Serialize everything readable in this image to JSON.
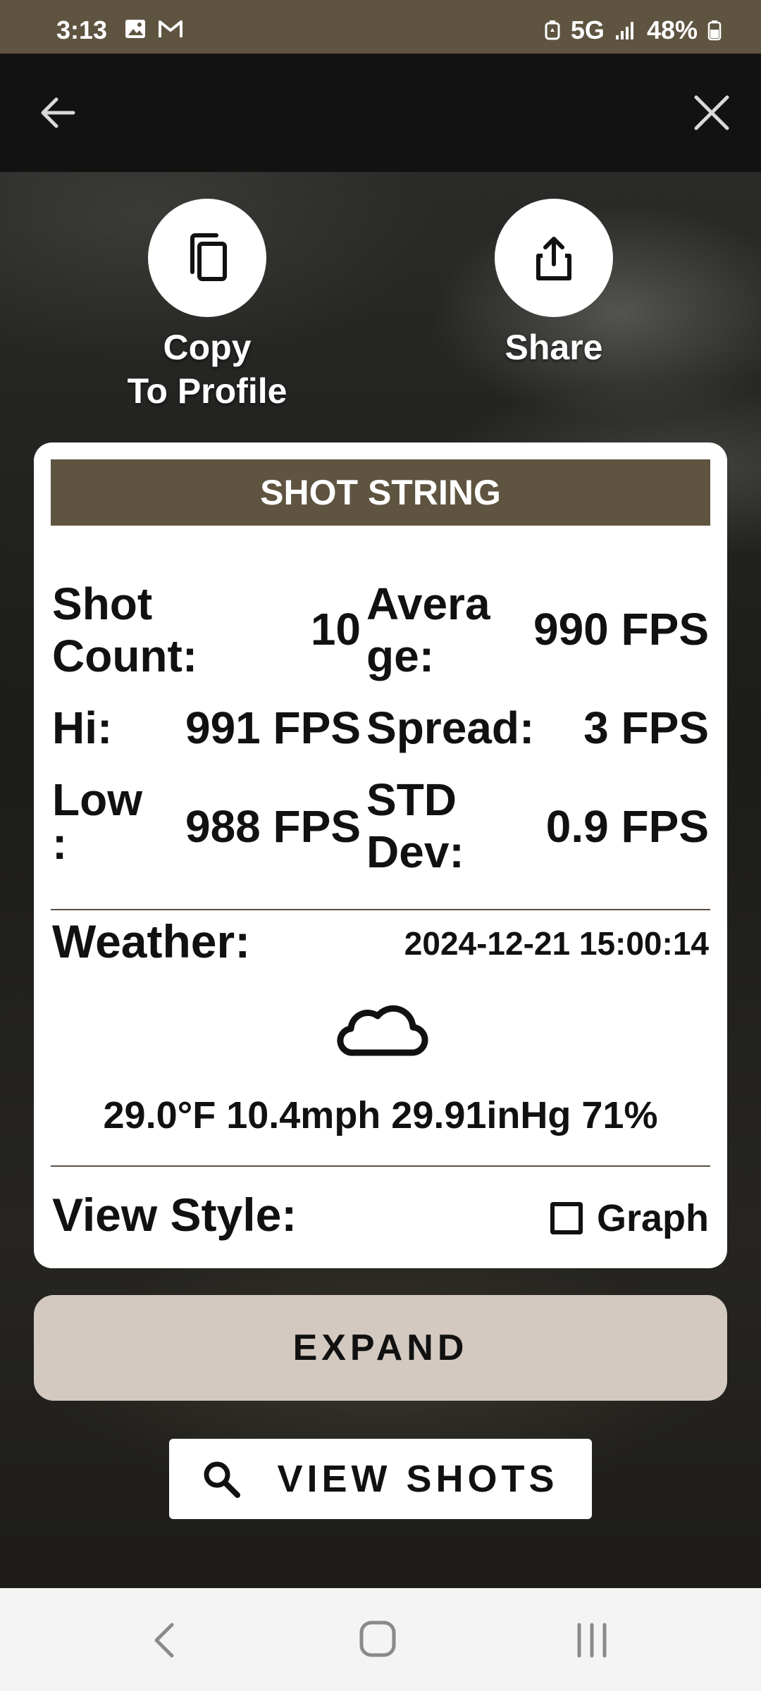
{
  "status_bar": {
    "time": "3:13",
    "network": "5G",
    "battery": "48%",
    "icons": [
      "gallery-icon",
      "gmail-icon",
      "battery-saver-icon",
      "signal-icon",
      "battery-icon"
    ]
  },
  "top_bar": {
    "icons": [
      "back-arrow-icon",
      "close-icon"
    ]
  },
  "actions": {
    "copy": {
      "line1": "Copy",
      "line2": "To Profile",
      "icon": "copy-icon"
    },
    "share": {
      "label": "Share",
      "icon": "share-icon"
    }
  },
  "card": {
    "header": "SHOT STRING",
    "stats": {
      "shot_count_label_1": "Shot",
      "shot_count_label_2": "Count:",
      "shot_count_value": "10",
      "average_label_1": "Avera",
      "average_label_2": "ge:",
      "average_value": "990 FPS",
      "hi_label": "Hi:",
      "hi_value": "991 FPS",
      "spread_label": "Spread:",
      "spread_value": "3 FPS",
      "low_label_1": "Low",
      "low_label_2": ":",
      "low_value": "988 FPS",
      "std_label_1": "STD",
      "std_label_2": "Dev:",
      "std_value": "0.9 FPS"
    },
    "weather": {
      "label": "Weather:",
      "timestamp": "2024-12-21 15:00:14",
      "icon": "cloud-icon",
      "values": "29.0°F 10.4mph 29.91inHg 71%"
    },
    "view_style": {
      "label": "View Style:",
      "graph_label": "Graph",
      "graph_checked": false
    }
  },
  "buttons": {
    "expand": "EXPAND",
    "view_shots": "VIEW SHOTS"
  },
  "colors": {
    "accent": "#5e5440",
    "expand_bg": "#d4c9c0"
  }
}
